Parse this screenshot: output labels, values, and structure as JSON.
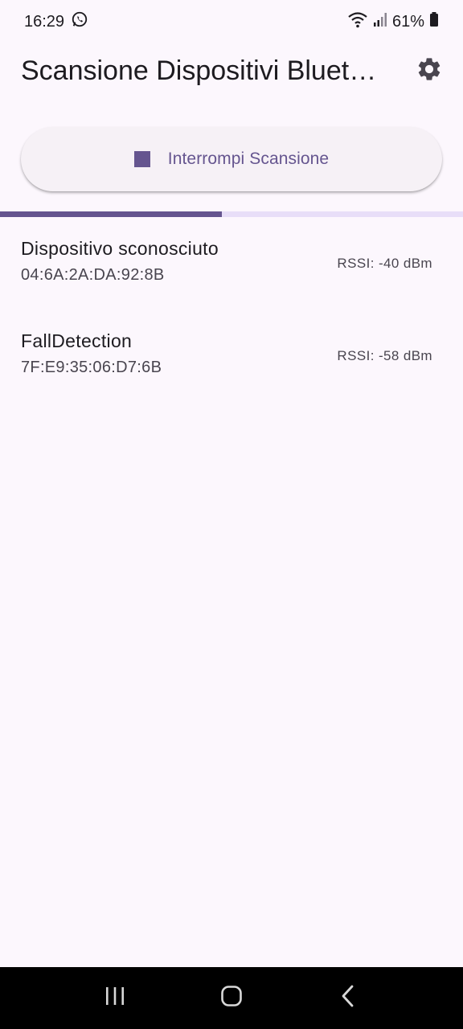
{
  "status_bar": {
    "time": "16:29",
    "battery_percent": "61%",
    "icons": [
      "whatsapp-icon",
      "wifi-icon",
      "signal-icon",
      "battery-icon"
    ]
  },
  "app_bar": {
    "title": "Scansione Dispositivi Bluetooth",
    "settings_icon": "gear-icon"
  },
  "scan_button": {
    "label": "Interrompi Scansione",
    "icon": "stop-icon"
  },
  "progress": {
    "value": 0.48
  },
  "devices": [
    {
      "name": "Dispositivo sconosciuto",
      "mac": "04:6A:2A:DA:92:8B",
      "rssi": "RSSI: -40 dBm"
    },
    {
      "name": "FallDetection",
      "mac": "7F:E9:35:06:D7:6B",
      "rssi": "RSSI: -58 dBm"
    }
  ],
  "nav_bar": {
    "items": [
      "recent-apps-icon",
      "home-icon",
      "back-icon"
    ]
  },
  "colors": {
    "background": "#fcf7fd",
    "accent": "#65558f",
    "progress_track": "#e8def8",
    "button_surface": "#f6f1f6"
  }
}
